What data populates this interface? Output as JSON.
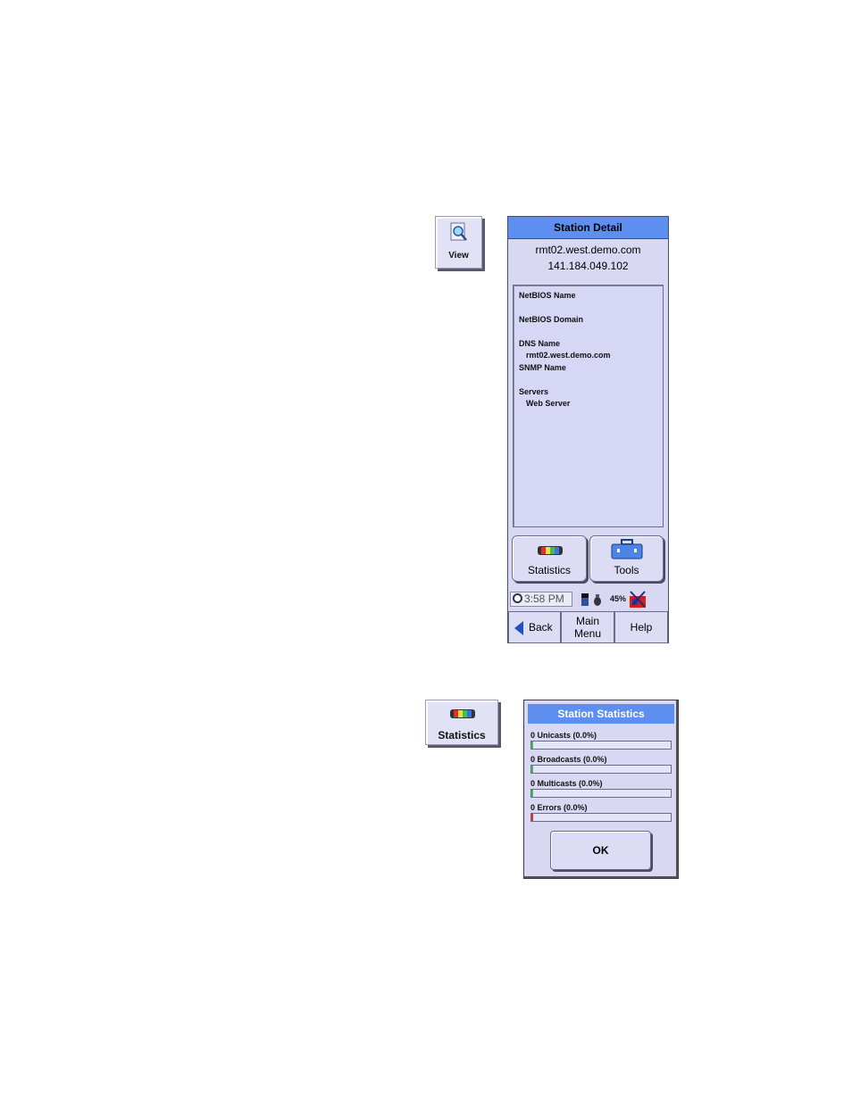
{
  "view_button": {
    "label": "View",
    "icon": "magnifier-icon"
  },
  "station_detail": {
    "title": "Station Detail",
    "hostname": "rmt02.west.demo.com",
    "ip": "141.184.049.102",
    "fields": [
      {
        "label": "NetBIOS Name",
        "value": ""
      },
      {
        "label": "NetBIOS Domain",
        "value": ""
      },
      {
        "label": "DNS Name",
        "value": "rmt02.west.demo.com"
      },
      {
        "label": "SNMP Name",
        "value": ""
      },
      {
        "label": "Servers",
        "value": "Web Server"
      }
    ],
    "statistics_button": "Statistics",
    "tools_button": "Tools",
    "status": {
      "time": "3:58 PM",
      "battery": "45%"
    },
    "nav": {
      "back": "Back",
      "main_menu_1": "Main",
      "main_menu_2": "Menu",
      "help": "Help"
    }
  },
  "statistics_button_standalone": {
    "label": "Statistics"
  },
  "station_statistics": {
    "title": "Station Statistics",
    "rows": [
      {
        "label": "0 Unicasts (0.0%)",
        "percent": 0.0,
        "color": "#3cc04a"
      },
      {
        "label": "0 Broadcasts (0.0%)",
        "percent": 0.0,
        "color": "#3cc04a"
      },
      {
        "label": "0 Multicasts (0.0%)",
        "percent": 0.0,
        "color": "#3cc04a"
      },
      {
        "label": "0 Errors (0.0%)",
        "percent": 0.0,
        "color": "#e03030"
      }
    ],
    "ok_button": "OK"
  },
  "colors": {
    "title_blue": "#5e8ef0",
    "panel_bg": "#d8d8f2"
  }
}
